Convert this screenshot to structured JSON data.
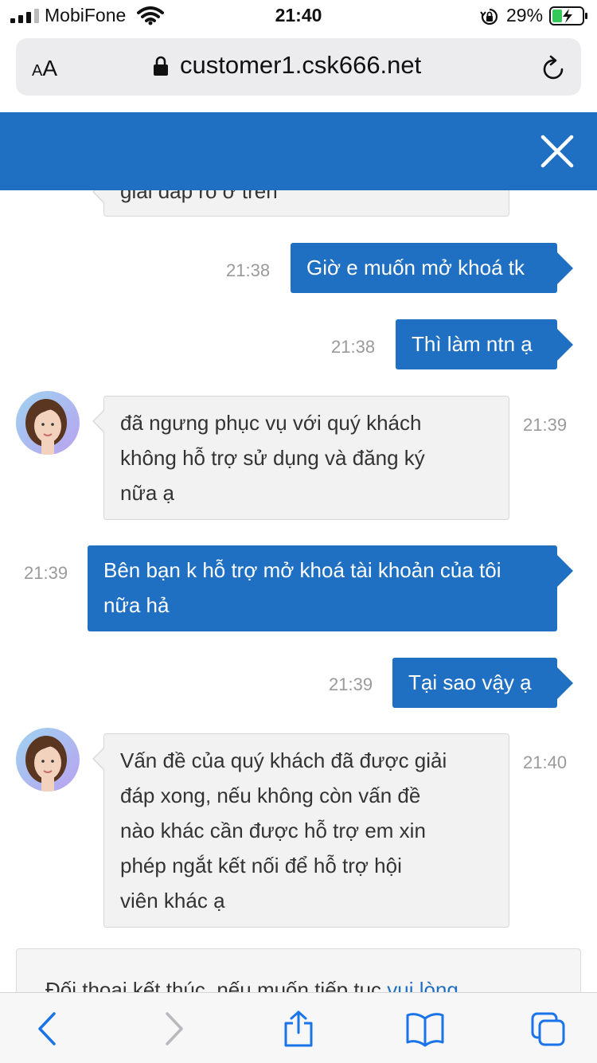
{
  "status_bar": {
    "carrier": "MobiFone",
    "time": "21:40",
    "battery_percent": "29%"
  },
  "browser": {
    "text_size_label_small": "A",
    "text_size_label_large": "A",
    "url": "customer1.csk666.net"
  },
  "chat": {
    "partial_top_text": "giải đáp rõ ở trên",
    "messages": [
      {
        "from": "user",
        "text": "Giờ e muốn mở khoá tk",
        "time": "21:38"
      },
      {
        "from": "user",
        "text": "Thì làm ntn ạ",
        "time": "21:38"
      },
      {
        "from": "agent",
        "lines": [
          "đã ngưng phục vụ với quý khách",
          "không hỗ trợ sử dụng và đăng ký",
          "nữa ạ"
        ],
        "time": "21:39"
      },
      {
        "from": "user",
        "lines": [
          "Bên bạn k hỗ trợ mở khoá tài khoản của tôi",
          "nữa hả"
        ],
        "time": "21:39"
      },
      {
        "from": "user",
        "text": "Tại sao vậy ạ",
        "time": "21:39"
      },
      {
        "from": "agent",
        "lines": [
          "Vấn đề của quý khách đã được giải",
          "đáp xong, nếu không còn vấn đề",
          "nào khác cần được hỗ trợ em xin",
          "phép ngắt kết nối để hỗ trợ hội",
          "viên khác ạ"
        ],
        "time": "21:40"
      }
    ],
    "end_notice": {
      "text": "Đối thoại kết thúc, nếu muốn tiếp tục ",
      "link": "vui lòng"
    }
  },
  "colors": {
    "accent": "#1f6fc3",
    "agent_bubble": "#f2f2f2",
    "timestamp": "#9a9a9a"
  },
  "toolbar_icons": [
    "back-icon",
    "forward-icon",
    "share-icon",
    "bookmarks-icon",
    "tabs-icon"
  ]
}
